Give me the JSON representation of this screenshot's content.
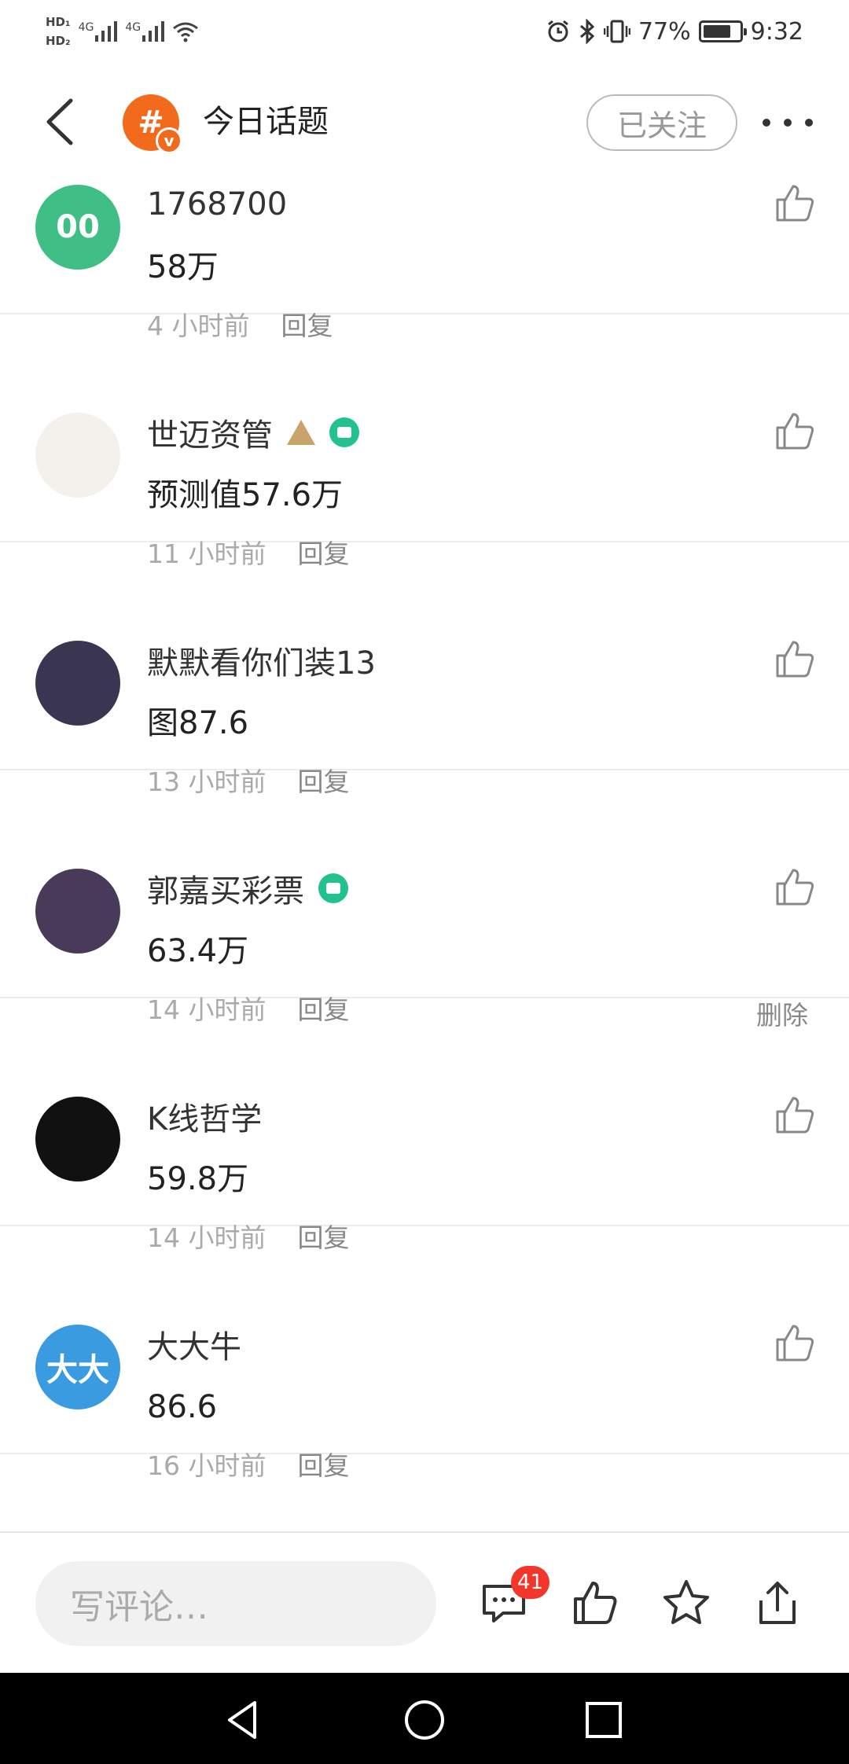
{
  "status_bar": {
    "hd1": "HD₁",
    "hd2": "HD₂",
    "sig1_label": "4G",
    "sig2_label": "4G",
    "battery_text": "77%",
    "battery_level": 0.77,
    "time": "9:32",
    "icons": [
      "alarm-icon",
      "bluetooth-icon",
      "vibrate-icon",
      "battery-icon"
    ]
  },
  "header": {
    "title": "今日话题",
    "logo_glyph": "#",
    "logo_badge": "v",
    "follow_label": "已关注"
  },
  "comments": [
    {
      "avatar_text": "00",
      "avatar_color": "#3fbf86",
      "name": "1768700",
      "text": "58万",
      "time": "4 小时前",
      "reply": "回复",
      "badges": []
    },
    {
      "avatar_text": "",
      "avatar_color": "#f4f0ec",
      "name": "世迈资管",
      "text": "预测值57.6万",
      "time": "11 小时前",
      "reply": "回复",
      "badges": [
        "triangle",
        "verified"
      ]
    },
    {
      "avatar_text": "",
      "avatar_color": "#3a3550",
      "name": "默默看你们装13",
      "text": "图87.6",
      "time": "13 小时前",
      "reply": "回复",
      "badges": []
    },
    {
      "avatar_text": "",
      "avatar_color": "#4a3a5a",
      "name": "郭嘉买彩票",
      "text": "63.4万",
      "time": "14 小时前",
      "reply": "回复",
      "badges": [
        "verified"
      ],
      "delete": "删除"
    },
    {
      "avatar_text": "",
      "avatar_color": "#111111",
      "name": "K线哲学",
      "text": "59.8万",
      "time": "14 小时前",
      "reply": "回复",
      "badges": []
    },
    {
      "avatar_text": "大大",
      "avatar_color": "#3a9be0",
      "name": "大大牛",
      "text": "86.6",
      "time": "16 小时前",
      "reply": "回复",
      "badges": []
    }
  ],
  "bottom_bar": {
    "input_placeholder": "写评论…",
    "comment_count": "41"
  },
  "colors": {
    "accent_orange": "#f26b1d",
    "verified_green": "#22c28a",
    "badge_red": "#f2362a"
  }
}
